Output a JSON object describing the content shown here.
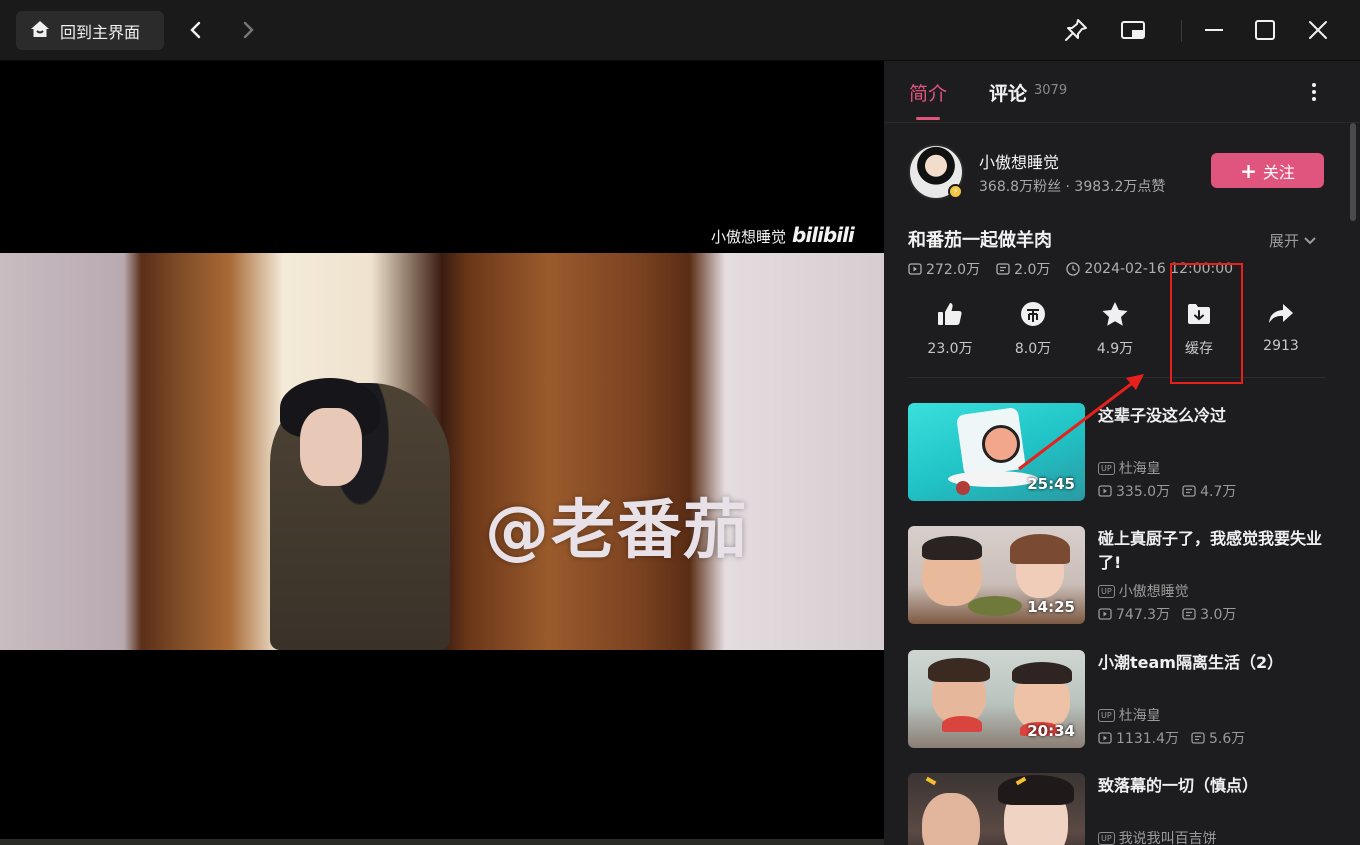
{
  "titlebar": {
    "home_label": "回到主界面",
    "icons": [
      "home-icon",
      "chevron-left-icon",
      "chevron-right-icon",
      "pin-icon",
      "mini-window-icon",
      "minimize-icon",
      "maximize-icon",
      "close-icon"
    ]
  },
  "player": {
    "brand_watermark_name": "小傲想睡觉",
    "brand_watermark_logo": "bilibili",
    "overlay_text": "@老番茄"
  },
  "sidebar": {
    "tabs": [
      {
        "label": "简介",
        "active": true
      },
      {
        "label": "评论",
        "count": "3079"
      }
    ],
    "uploader": {
      "name": "小傲想睡觉",
      "stats": "368.8万粉丝 · 3983.2万点赞",
      "follow_label": "关注"
    },
    "video": {
      "title": "和番茄一起做羊肉",
      "expand_label": "展开",
      "views": "272.0万",
      "danmaku": "2.0万",
      "date": "2024-02-16 12:00:00"
    },
    "actions": [
      {
        "name": "like",
        "icon": "thumbs-up-icon",
        "count": "23.0万"
      },
      {
        "name": "coin",
        "icon": "coin-icon",
        "count": "8.0万"
      },
      {
        "name": "favorite",
        "icon": "star-icon",
        "count": "4.9万"
      },
      {
        "name": "cache",
        "icon": "download-folder-icon",
        "count": "缓存"
      },
      {
        "name": "share",
        "icon": "share-icon",
        "count": "2913"
      }
    ],
    "recommendations": [
      {
        "title": "这辈子没这么冷过",
        "uploader": "杜海皇",
        "views": "335.0万",
        "danmaku": "4.7万",
        "duration": "25:45"
      },
      {
        "title": "碰上真厨子了，我感觉我要失业了!",
        "uploader": "小傲想睡觉",
        "views": "747.3万",
        "danmaku": "3.0万",
        "duration": "14:25"
      },
      {
        "title": "小潮team隔离生活（2）",
        "uploader": "杜海皇",
        "views": "1131.4万",
        "danmaku": "5.6万",
        "duration": "20:34"
      },
      {
        "title": "致落幕的一切（慎点）",
        "uploader": "我说我叫百吉饼",
        "views": "",
        "danmaku": "",
        "duration": ""
      }
    ],
    "up_tag": "UP"
  },
  "colors": {
    "accent": "#e0557e",
    "annotation_red": "#e8201c"
  }
}
